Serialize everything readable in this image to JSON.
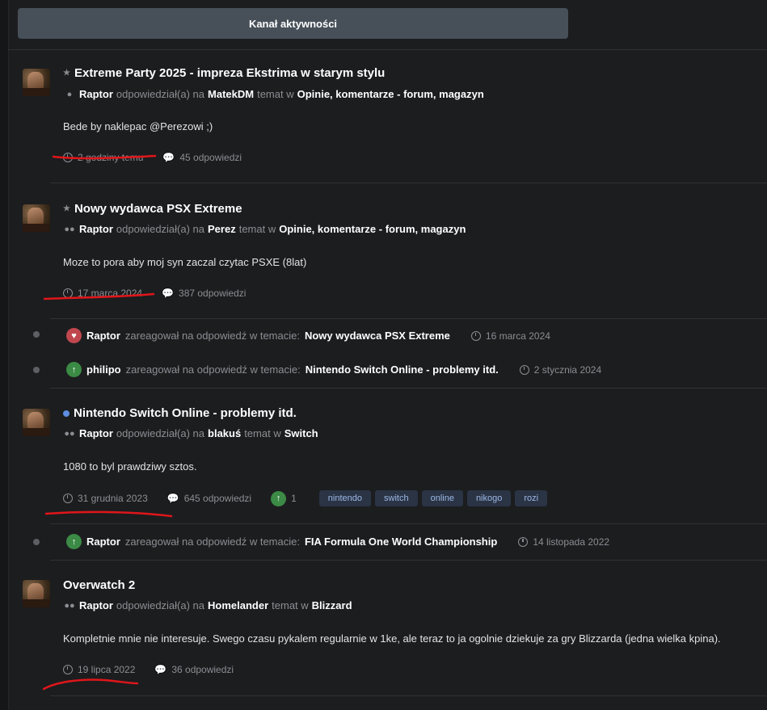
{
  "feed_button": "Kanał aktywności",
  "posts": [
    {
      "title": "Extreme Party 2025 - impreza Ekstrima w starym stylu",
      "author": "Raptor",
      "action": "odpowiedział(a) na",
      "target_user": "MatekDM",
      "topic_word": "temat w",
      "forum": "Opinie, komentarze - forum, magazyn",
      "body": "Bede by naklepac @Perezowi ;)",
      "time": "2 godziny temu",
      "replies": "45 odpowiedzi"
    },
    {
      "title": "Nowy wydawca PSX Extreme",
      "author": "Raptor",
      "action": "odpowiedział(a) na",
      "target_user": "Perez",
      "topic_word": "temat w",
      "forum": "Opinie, komentarze - forum, magazyn",
      "body": "Moze to pora aby moj syn zaczal czytac PSXE (8lat)",
      "time": "17 marca 2024",
      "replies": "387 odpowiedzi"
    },
    {
      "title": "Nintendo Switch Online - problemy itd.",
      "author": "Raptor",
      "action": "odpowiedział(a) na",
      "target_user": "blakuś",
      "topic_word": "temat w",
      "forum": "Switch",
      "body": "1080 to byl prawdziwy sztos.",
      "time": "31 grudnia 2023",
      "replies": "645 odpowiedzi",
      "upvotes": "1",
      "tags": [
        "nintendo",
        "switch",
        "online",
        "nikogo",
        "rozi"
      ]
    },
    {
      "title": "Overwatch 2",
      "author": "Raptor",
      "action": "odpowiedział(a) na",
      "target_user": "Homelander",
      "topic_word": "temat w",
      "forum": "Blizzard",
      "body": "Kompletnie mnie nie interesuje. Swego czasu pykalem regularnie w 1ke, ale teraz to ja ogolnie dziekuje za gry Blizzarda (jedna wielka kpina).",
      "time": "19 lipca 2022",
      "replies": "36 odpowiedzi"
    }
  ],
  "reactions": [
    {
      "user": "Raptor",
      "text": "zareagował na odpowiedź w temacie:",
      "topic": "Nowy wydawca PSX Extreme",
      "date": "16 marca 2024",
      "icon": "heart-icon"
    },
    {
      "user": "philipo",
      "text": "zareagował na odpowiedź w temacie:",
      "topic": "Nintendo Switch Online - problemy itd.",
      "date": "2 stycznia 2024",
      "icon": "upvote-icon"
    },
    {
      "user": "Raptor",
      "text": "zareagował na odpowiedź w temacie:",
      "topic": "FIA Formula One World Championship",
      "date": "14 listopada 2022",
      "icon": "upvote-icon"
    }
  ],
  "colors": {
    "accent_tag_bg": "#2a3445",
    "tag_text": "#9db8e6",
    "heart": "#c0474e",
    "upvote": "#3b8a45",
    "annotation_red": "#e0161a"
  }
}
